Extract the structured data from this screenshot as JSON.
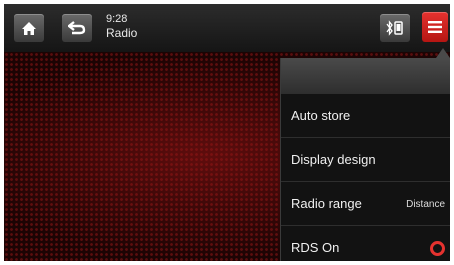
{
  "status": {
    "time": "9:28",
    "source": "Radio"
  },
  "icons": {
    "home": "home-icon",
    "back": "back-icon",
    "bluetooth_phone": "bluetooth-phone-icon",
    "menu": "menu-icon"
  },
  "menu": {
    "items": [
      {
        "label": "Auto store",
        "value": ""
      },
      {
        "label": "Display design",
        "value": ""
      },
      {
        "label": "Radio range",
        "value": "Distance"
      },
      {
        "label": "RDS On",
        "value": ""
      }
    ],
    "rds_on": true
  },
  "colors": {
    "accent": "#e5322f",
    "background": "#1c0404"
  }
}
